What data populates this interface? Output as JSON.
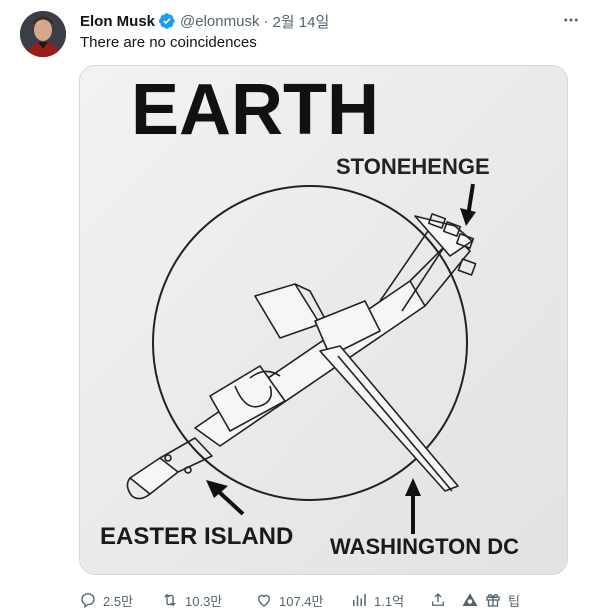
{
  "author": {
    "name": "Elon Musk",
    "handle": "@elonmusk",
    "separator": "·",
    "date": "2월 14일"
  },
  "tweet": {
    "text": "There are no coincidences"
  },
  "image": {
    "title": "EARTH",
    "labels": {
      "stonehenge": "STONEHENGE",
      "easter_island": "EASTER ISLAND",
      "washington": "WASHINGTON DC"
    }
  },
  "actions": {
    "replies": "2.5만",
    "reposts": "10.3만",
    "likes": "107.4만",
    "views": "1.1억",
    "tip": "팁"
  },
  "colors": {
    "verified": "#1d9bf0",
    "muted": "#536471"
  },
  "icons": [
    "verified-badge-icon",
    "more-icon",
    "reply-icon",
    "repost-icon",
    "like-icon",
    "views-icon",
    "bookmark-icon",
    "share-icon",
    "tip-icon"
  ]
}
